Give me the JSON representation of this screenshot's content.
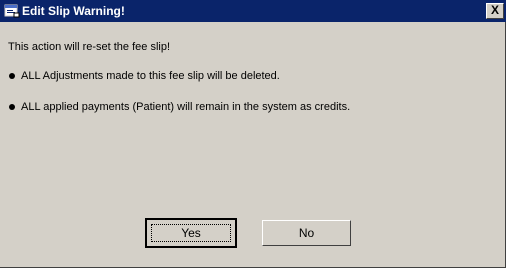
{
  "window": {
    "title": "Edit Slip Warning!",
    "close_label": "X"
  },
  "message": {
    "intro": "This action will re-set the fee slip!",
    "bullets": [
      "ALL Adjustments made to this fee slip will be deleted.",
      "ALL applied payments (Patient) will remain in the system as credits."
    ]
  },
  "buttons": {
    "yes_label": "Yes",
    "no_label": "No"
  },
  "icons": {
    "title": "application-window-icon"
  },
  "colors": {
    "titlebar": "#0a246a",
    "dialog_face": "#d4d0c8"
  }
}
